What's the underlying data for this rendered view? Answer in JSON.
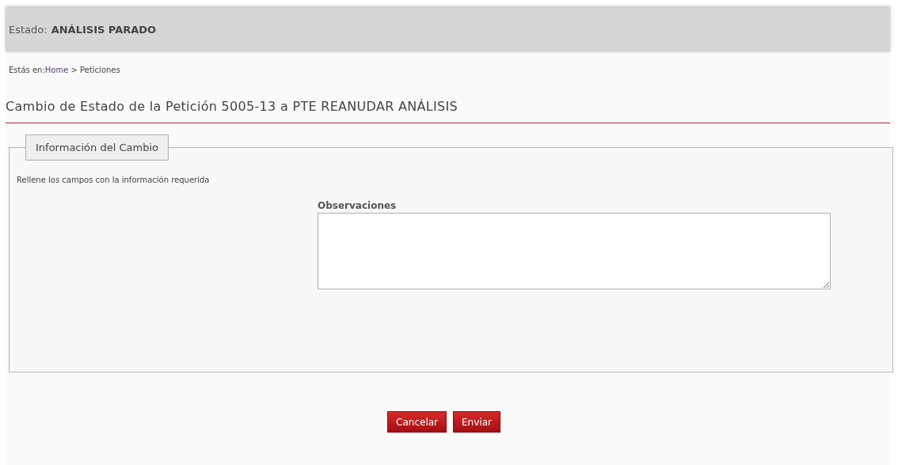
{
  "status_bar": {
    "label": "Estado:",
    "value": "ANÁLISIS PARADO"
  },
  "breadcrumb": {
    "prefix": "Estás en:",
    "link": "Home",
    "rest": " > Peticiones"
  },
  "title": "Cambio de Estado de la Petición 5005-13 a PTE REANUDAR ANÁLISIS",
  "fieldset": {
    "legend": "Información del Cambio",
    "instructions": "Rellene los campos con la información requerida",
    "field": {
      "label": "Observaciones"
    }
  },
  "buttons": [
    "Cancelar",
    "Enviar"
  ]
}
